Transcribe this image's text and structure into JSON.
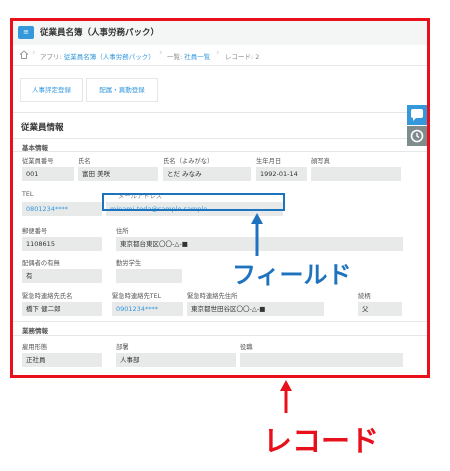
{
  "app": {
    "icon": "app-icon",
    "title": "従業員名簿（人事労務パック）"
  },
  "breadcrumb": {
    "prefix": "アプリ:",
    "app_link": "従業員名簿（人事労務パック）",
    "list_prefix": "一覧:",
    "list_link": "社員一覧",
    "record": "レコード: 2"
  },
  "actions": {
    "button1": "人事評定登録",
    "button2": "配属・異動登録"
  },
  "section": {
    "title": "従業員情報"
  },
  "groups": {
    "basic": "基本情報",
    "employment": "業務情報"
  },
  "fields": {
    "employee_no": {
      "label": "従業員番号",
      "value": "001"
    },
    "name": {
      "label": "氏名",
      "value": "富田 美咲"
    },
    "name_kana": {
      "label": "氏名（よみがな）",
      "value": "とだ みなみ"
    },
    "birthdate": {
      "label": "生年月日",
      "value": "1992-01-14"
    },
    "photo": {
      "label": "顔写真",
      "value": ""
    },
    "tel": {
      "label": "TEL",
      "value": "0801234****"
    },
    "email": {
      "label": "メールアドレス",
      "value": "minami-toda@sample.sample"
    },
    "postal": {
      "label": "郵便番号",
      "value": "1108615"
    },
    "address": {
      "label": "住所",
      "value": "東京都台東区〇〇-△-■"
    },
    "spouse": {
      "label": "配偶者の有無",
      "value": "有"
    },
    "working_student": {
      "label": "勤労学生",
      "value": ""
    },
    "emergency_name": {
      "label": "緊急時連絡先氏名",
      "value": "橋下 健二郎"
    },
    "emergency_tel": {
      "label": "緊急時連絡先TEL",
      "value": "0901234****"
    },
    "emergency_address": {
      "label": "緊急時連絡先住所",
      "value": "東京都世田谷区〇〇-△-■"
    },
    "relation": {
      "label": "続柄",
      "value": "父"
    },
    "employment_type": {
      "label": "雇用形態",
      "value": "正社員"
    },
    "department": {
      "label": "部署",
      "value": "人事部"
    },
    "position": {
      "label": "役職",
      "value": ""
    }
  },
  "annotations": {
    "field_label": "フィールド",
    "record_label": "レコード"
  },
  "colors": {
    "record_red": "#e8101a",
    "field_blue": "#1e73be",
    "kintone_blue": "#3498db"
  },
  "icons": {
    "comment": "comment-icon",
    "history": "history-icon",
    "home": "home-icon"
  }
}
